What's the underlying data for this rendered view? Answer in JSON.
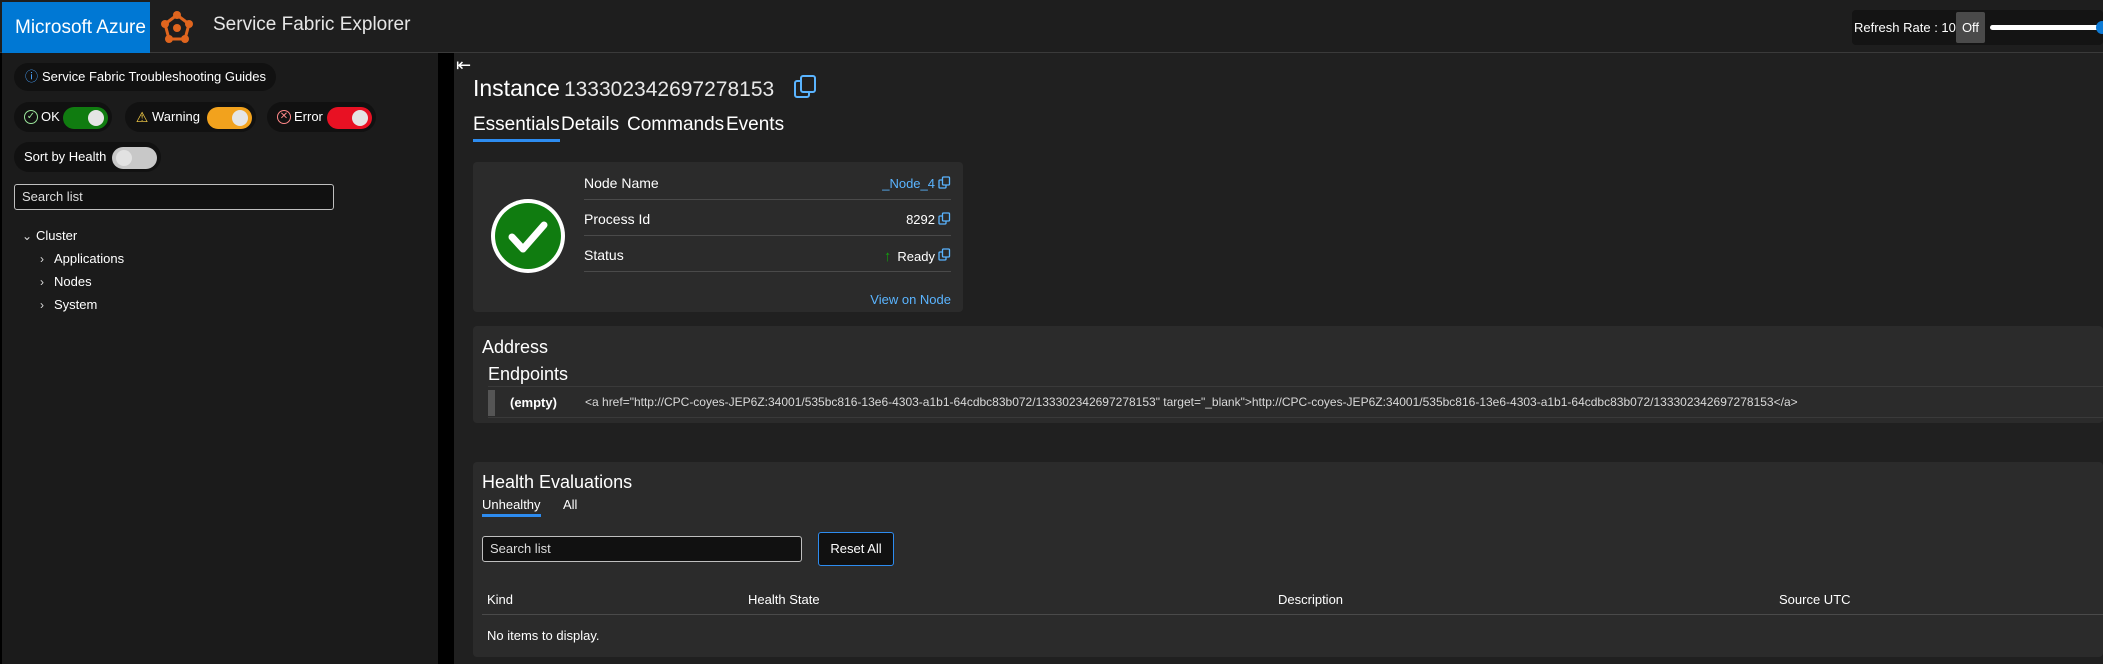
{
  "topbar": {
    "brand": "Microsoft Azure",
    "app_title": "Service Fabric Explorer",
    "refresh_label": "Refresh Rate : 10",
    "refresh_off": "Off",
    "refresh_level": 1.0
  },
  "sidebar": {
    "guides_label": "Service Fabric Troubleshooting Guides",
    "filters": {
      "ok": "OK",
      "warning": "Warning",
      "error": "Error"
    },
    "sort_label": "Sort by Health",
    "search_placeholder": "Search list",
    "tree": {
      "root": "Cluster",
      "children": [
        "Applications",
        "Nodes",
        "System"
      ]
    }
  },
  "main": {
    "title": "Instance",
    "instance_id": "133302342697278153",
    "tabs": [
      "Essentials",
      "Details",
      "Commands",
      "Events"
    ],
    "essentials": {
      "rows": [
        {
          "key": "Node Name",
          "value": "_Node_4"
        },
        {
          "key": "Process Id",
          "value": "8292"
        },
        {
          "key": "Status",
          "value": "Ready"
        }
      ],
      "view_on_node": "View on Node"
    },
    "address": {
      "title": "Address",
      "endpoints_title": "Endpoints",
      "endpoint_key": "(empty)",
      "endpoint_value": "<a href=\"http://CPC-coyes-JEP6Z:34001/535bc816-13e6-4303-a1b1-64cdbc83b072/133302342697278153\" target=\"_blank\">http://CPC-coyes-JEP6Z:34001/535bc816-13e6-4303-a1b1-64cdbc83b072/133302342697278153</a>"
    },
    "health": {
      "title": "Health Evaluations",
      "tabs": [
        "Unhealthy",
        "All"
      ],
      "search_placeholder": "Search list",
      "reset_label": "Reset All",
      "columns": [
        "Kind",
        "Health State",
        "Description",
        "Source UTC"
      ],
      "empty_text": "No items to display."
    }
  },
  "colors": {
    "brand_blue": "#0078d4",
    "ok_green": "#107c10",
    "warning_orange": "#f2a21d",
    "error_red": "#e81123",
    "link_blue": "#5ab4ff"
  }
}
